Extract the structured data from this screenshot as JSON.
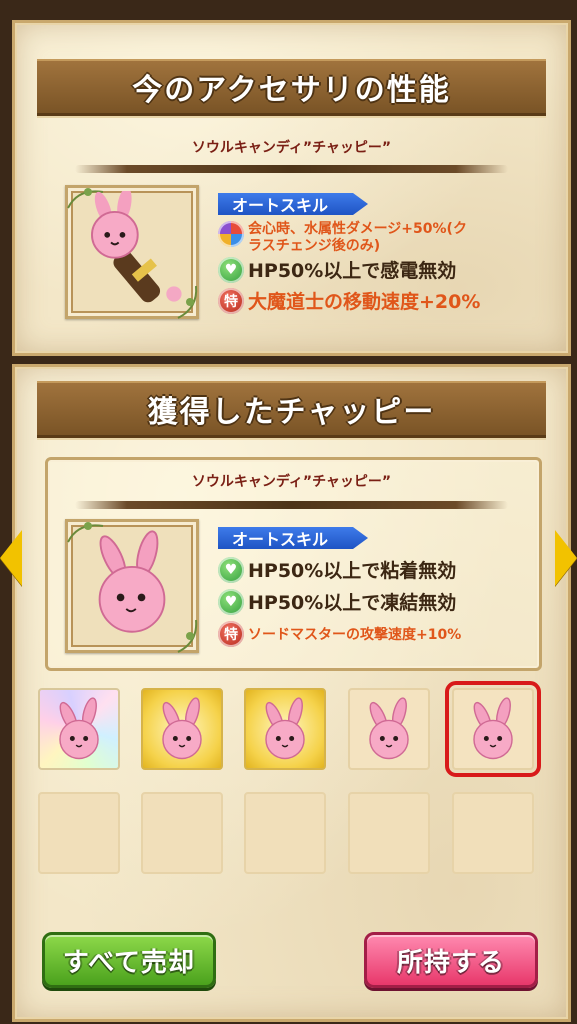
{
  "current": {
    "banner": "今のアクセサリの性能",
    "item_name": "ソウルキャンディ”チャッピー”",
    "auto_skill_label": "オートスキル",
    "skills": [
      {
        "icon": "multi-element-icon",
        "text": "会心時、水属性ダメージ+50%(クラスチェンジ後のみ)",
        "color": "#e0561a"
      },
      {
        "icon": "shield-heart-icon",
        "text": "HP50%以上で感電無効",
        "color": "#3c2713"
      },
      {
        "icon": "special-icon",
        "glyph": "特",
        "text": "大魔道士の移動速度+20%",
        "color": "#e0561a"
      }
    ]
  },
  "obtained": {
    "banner": "獲得したチャッピー",
    "item_name": "ソウルキャンディ”チャッピー”",
    "auto_skill_label": "オートスキル",
    "skills": [
      {
        "icon": "shield-heart-icon",
        "text": "HP50%以上で粘着無効",
        "color": "#3c2713"
      },
      {
        "icon": "shield-heart-icon",
        "text": "HP50%以上で凍結無効",
        "color": "#3c2713"
      },
      {
        "icon": "special-icon",
        "glyph": "特",
        "text": "ソードマスターの攻撃速度+10%",
        "color": "#e0561a"
      }
    ]
  },
  "slots": [
    {
      "style": "rainbow",
      "item": "chappy-rabbit-icon",
      "selected": false
    },
    {
      "style": "gold",
      "item": "chappy-rabbit-icon",
      "selected": false
    },
    {
      "style": "gold",
      "item": "chappy-rabbit-icon",
      "selected": false
    },
    {
      "style": "plain",
      "item": "chappy-rabbit-icon",
      "selected": false
    },
    {
      "style": "plain",
      "item": "chappy-rabbit-icon",
      "selected": true
    },
    {
      "style": "empty",
      "item": null,
      "selected": false
    },
    {
      "style": "empty",
      "item": null,
      "selected": false
    },
    {
      "style": "empty",
      "item": null,
      "selected": false
    },
    {
      "style": "empty",
      "item": null,
      "selected": false
    },
    {
      "style": "empty",
      "item": null,
      "selected": false
    }
  ],
  "buttons": {
    "sell_all": "すべて売却",
    "keep": "所持する"
  },
  "colors": {
    "banner": "#8a6030",
    "item_name": "#7a1f14",
    "skill_tag": "#2a60d8",
    "selected_outline": "#d81a1a",
    "arrow": "#f2c200"
  }
}
